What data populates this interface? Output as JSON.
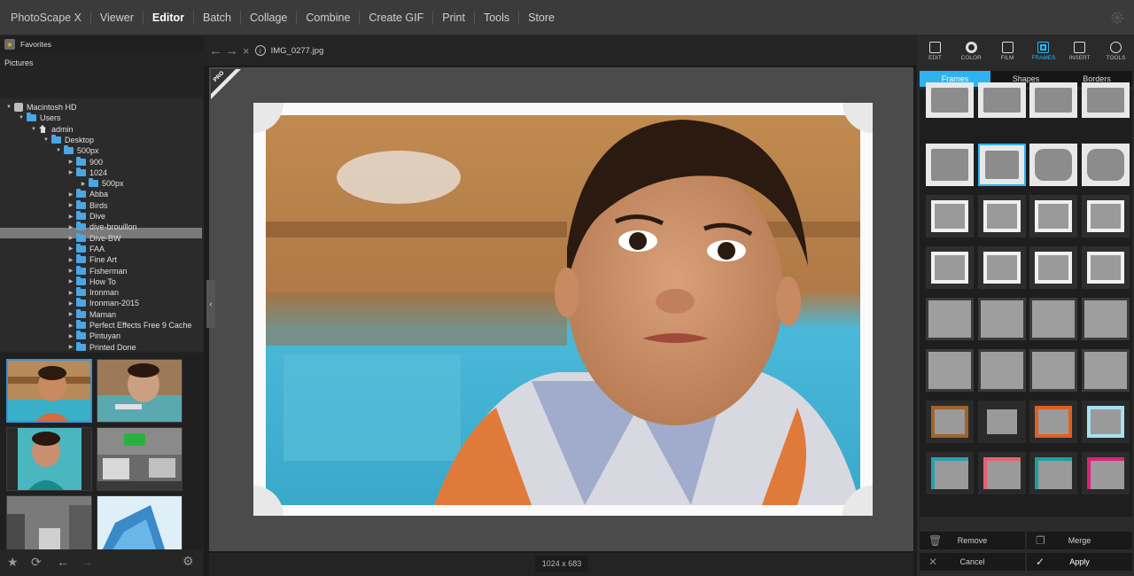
{
  "app": {
    "name": "PhotoScape X"
  },
  "menu": [
    "Viewer",
    "Editor",
    "Batch",
    "Collage",
    "Combine",
    "Create GIF",
    "Print",
    "Tools",
    "Store"
  ],
  "menu_active": "Editor",
  "sidebar": {
    "favorites_label": "Favorites",
    "pictures_label": "Pictures",
    "tree": [
      {
        "label": "Macintosh HD",
        "level": 0,
        "icon": "hdd-icon",
        "expanded": true
      },
      {
        "label": "Users",
        "level": 1,
        "icon": "folder-icon",
        "expanded": true
      },
      {
        "label": "admin",
        "level": 2,
        "icon": "home-icon",
        "expanded": true
      },
      {
        "label": "Desktop",
        "level": 3,
        "icon": "folder-icon",
        "expanded": true
      },
      {
        "label": "500px",
        "level": 4,
        "icon": "folder-icon",
        "expanded": true
      },
      {
        "label": "900",
        "level": 5,
        "icon": "folder-icon",
        "expanded": false
      },
      {
        "label": "1024",
        "level": 5,
        "icon": "folder-icon",
        "expanded": false,
        "selected": true
      },
      {
        "label": "500px",
        "level": 6,
        "icon": "folder-icon",
        "expanded": false
      },
      {
        "label": "Abba",
        "level": 5,
        "icon": "folder-icon",
        "expanded": false
      },
      {
        "label": "Birds",
        "level": 5,
        "icon": "folder-icon",
        "expanded": false
      },
      {
        "label": "Dive",
        "level": 5,
        "icon": "folder-icon",
        "expanded": false
      },
      {
        "label": "dive-brouillon",
        "level": 5,
        "icon": "folder-icon",
        "expanded": false
      },
      {
        "label": "Dive-BW",
        "level": 5,
        "icon": "folder-icon",
        "expanded": false
      },
      {
        "label": "FAA",
        "level": 5,
        "icon": "folder-icon",
        "expanded": false
      },
      {
        "label": "Fine Art",
        "level": 5,
        "icon": "folder-icon",
        "expanded": false
      },
      {
        "label": "Fisherman",
        "level": 5,
        "icon": "folder-icon",
        "expanded": false
      },
      {
        "label": "How To",
        "level": 5,
        "icon": "folder-icon",
        "expanded": false
      },
      {
        "label": "Ironman",
        "level": 5,
        "icon": "folder-icon",
        "expanded": false
      },
      {
        "label": "Ironman-2015",
        "level": 5,
        "icon": "folder-icon",
        "expanded": false
      },
      {
        "label": "Maman",
        "level": 5,
        "icon": "folder-icon",
        "expanded": false
      },
      {
        "label": "Perfect Effects Free 9 Cache",
        "level": 5,
        "icon": "folder-icon",
        "expanded": false
      },
      {
        "label": "Pintuyan",
        "level": 5,
        "icon": "folder-icon",
        "expanded": false
      },
      {
        "label": "Printed Done",
        "level": 5,
        "icon": "folder-icon",
        "expanded": false
      }
    ]
  },
  "editor": {
    "filename": "IMG_0277.jpg",
    "dimensions": "1024 x 683",
    "pro_badge": "PRO"
  },
  "tools": [
    {
      "label": "EDIT",
      "icon": "edit-icon"
    },
    {
      "label": "COLOR",
      "icon": "color-icon"
    },
    {
      "label": "FILM",
      "icon": "film-icon"
    },
    {
      "label": "FRAMES",
      "icon": "frames-icon",
      "active": true
    },
    {
      "label": "INSERT",
      "icon": "insert-icon"
    },
    {
      "label": "TOOLS",
      "icon": "tools-icon"
    }
  ],
  "frame_tabs": [
    "Frames",
    "Shapes",
    "Borders"
  ],
  "frame_tab_active": "Frames",
  "actions": {
    "remove": "Remove",
    "merge": "Merge",
    "cancel": "Cancel",
    "apply": "Apply"
  },
  "colors": {
    "accent": "#2db5f0",
    "frame_colors": [
      "#a0642a",
      "#2a2a2a",
      "#e06020",
      "#a8e0f0",
      "#2aa0b0",
      "#e86070",
      "#1aa0a0",
      "#e0207a"
    ]
  }
}
